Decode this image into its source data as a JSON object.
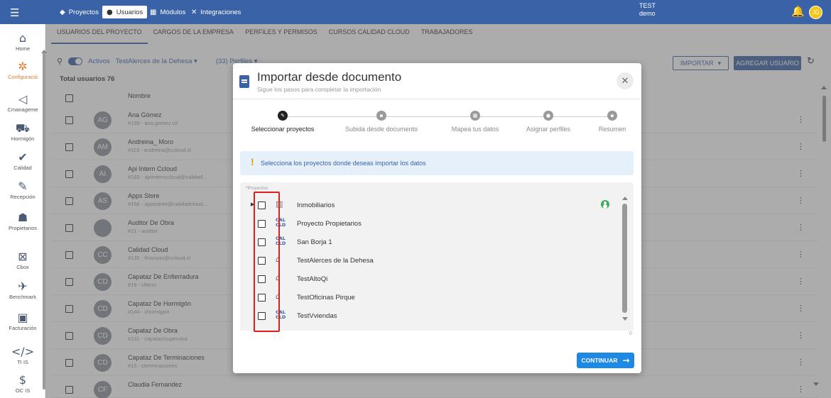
{
  "topbar": {
    "tabs": [
      {
        "label": "Proyectos",
        "icon": "tag-icon"
      },
      {
        "label": "Usuarios",
        "icon": "person-icon"
      },
      {
        "label": "Módulos",
        "icon": "grid-icon"
      },
      {
        "label": "Integraciones",
        "icon": "integration-icon"
      }
    ],
    "user_line1": "TEST",
    "user_line2": "demo",
    "avatar_initials": "JG"
  },
  "sidebar": {
    "items": [
      {
        "label": "Home",
        "icon": "home-icon"
      },
      {
        "label": "Configuració",
        "icon": "config-icon"
      },
      {
        "label": "Cmanageme",
        "icon": "cmanagement-icon"
      },
      {
        "label": "Hormigón",
        "icon": "concrete-icon"
      },
      {
        "label": "Calidad",
        "icon": "quality-icon"
      },
      {
        "label": "Recepción",
        "icon": "reception-icon"
      },
      {
        "label": "Propietarios",
        "icon": "owners-icon"
      },
      {
        "label": "Cbox",
        "icon": "cbox-icon"
      },
      {
        "label": "Benchmark",
        "icon": "benchmark-icon"
      },
      {
        "label": "Facturación",
        "icon": "billing-icon"
      },
      {
        "label": "TI IS",
        "icon": "code-icon"
      },
      {
        "label": "OC IS",
        "icon": "dollar-icon"
      }
    ]
  },
  "page_tabs": [
    "USUARIOS DEL PROYECTO",
    "CARGOS DE LA EMPRESA",
    "PERFILES Y PERMISOS",
    "CURSOS CALIDAD CLOUD",
    "TRABAJADORES"
  ],
  "toolbar": {
    "active_label": "Activos",
    "project_filter": "TestAlerces de la Dehesa",
    "profiles_filter": "(33) Perfiles",
    "import_label": "IMPORTAR",
    "add_user_label": "AGREGAR USUARIO"
  },
  "table": {
    "total_label": "Total usuarios 76",
    "name_header": "Nombre",
    "rows": [
      {
        "initials": "AG",
        "name": "Ana Gómez",
        "sub": "#199 - ana.gomez.v2"
      },
      {
        "initials": "AM",
        "name": "Andreina_ Moro",
        "sub": "#113 - andreina@ccloud.cl"
      },
      {
        "initials": "AI",
        "name": "Api Intern Ccloud",
        "sub": "#183 - apiinternccloud@calidad..."
      },
      {
        "initials": "AS",
        "name": "Apps Store",
        "sub": "#156 - appsstore@calidadcloud..."
      },
      {
        "initials": "",
        "name": "Auditor De Obra",
        "sub": "#21 - auditor"
      },
      {
        "initials": "CC",
        "name": "Calidad Cloud",
        "sub": "#135 - finanzas@ccloud.cl"
      },
      {
        "initials": "CD",
        "name": "Capataz De Enfierradura",
        "sub": "#19 - cfierro"
      },
      {
        "initials": "CD",
        "name": "Capataz De Hormigón",
        "sub": "#144 - chormigon"
      },
      {
        "initials": "CD",
        "name": "Capataz De Obra",
        "sub": "#131 - capataz/supervisa"
      },
      {
        "initials": "CD",
        "name": "Capataz De Terminaciones",
        "sub": "#15 - cterminaciones"
      },
      {
        "initials": "CF",
        "name": "Claudia Fernandez",
        "sub": ""
      }
    ]
  },
  "modal": {
    "title": "Importar desde documento",
    "subtitle": "Sigue los pasos para completar la importación",
    "steps": [
      "Seleccionar proyectos",
      "Subida desde documento",
      "Mapea tus datos",
      "Asignar perfiles",
      "Resumen"
    ],
    "info": "Selecciona los proyectos donde deseas importar los datos",
    "projects_label": "*Proyectos",
    "projects": [
      {
        "name": "Inmobiliarios",
        "icon": "building-icon"
      },
      {
        "name": "Proyecto Propietarios",
        "icon": "calidad-cloud-icon"
      },
      {
        "name": "San Borja 1",
        "icon": "calidad-cloud-icon"
      },
      {
        "name": "TestAlerces de la Dehesa",
        "icon": "houses-icon"
      },
      {
        "name": "TestAltoQi",
        "icon": "houses-icon"
      },
      {
        "name": "TestOficinas Pirque",
        "icon": "houses-icon"
      },
      {
        "name": "TestVviendas",
        "icon": "calidad-cloud-icon"
      }
    ],
    "counter": "0",
    "continue_label": "CONTINUAR"
  }
}
